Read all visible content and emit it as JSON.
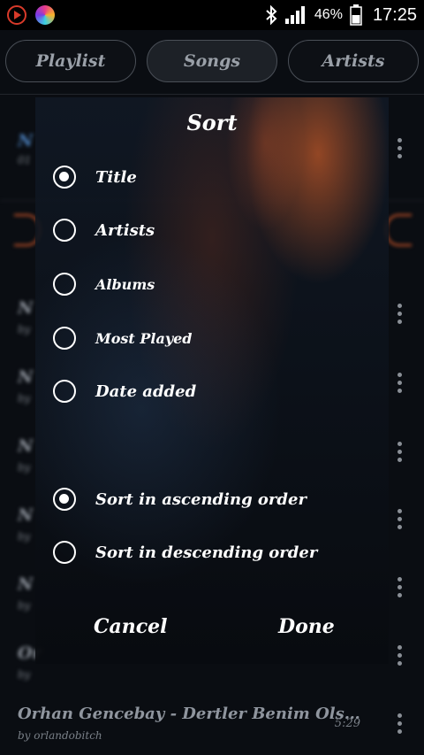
{
  "status_bar": {
    "battery_pct": "46%",
    "time": "17:25",
    "icons": [
      "play-app-icon",
      "color-app-icon",
      "bluetooth-icon",
      "signal-icon",
      "battery-icon"
    ]
  },
  "tabs": [
    {
      "label": "Playlist"
    },
    {
      "label": "Songs"
    },
    {
      "label": "Artists"
    }
  ],
  "background_list": {
    "top_item": {
      "title": "N",
      "subtitle": "01"
    },
    "rows": [
      {
        "title": "N",
        "subtitle": "by"
      },
      {
        "title": "N",
        "subtitle": "by"
      },
      {
        "title": "N",
        "subtitle": "by"
      },
      {
        "title": "N",
        "subtitle": "by"
      },
      {
        "title": "N",
        "subtitle": "by"
      },
      {
        "title": "Or",
        "subtitle": "by"
      }
    ],
    "last_row": {
      "title": "Orhan Gencebay - Dertler Benim Ols…",
      "subtitle": "by orlandobitch",
      "duration": "5:29"
    }
  },
  "dialog": {
    "title": "Sort",
    "sort_options": [
      {
        "label": "Title",
        "selected": true
      },
      {
        "label": "Artists",
        "selected": false
      },
      {
        "label": "Albums",
        "selected": false
      },
      {
        "label": "Most Played",
        "selected": false
      },
      {
        "label": "Date added",
        "selected": false
      }
    ],
    "order_options": [
      {
        "label": "Sort in ascending order",
        "selected": true
      },
      {
        "label": "Sort in descending order",
        "selected": false
      }
    ],
    "cancel_label": "Cancel",
    "done_label": "Done"
  },
  "colors": {
    "accent_orange": "#e8582a",
    "dialog_text": "#ffffff"
  }
}
